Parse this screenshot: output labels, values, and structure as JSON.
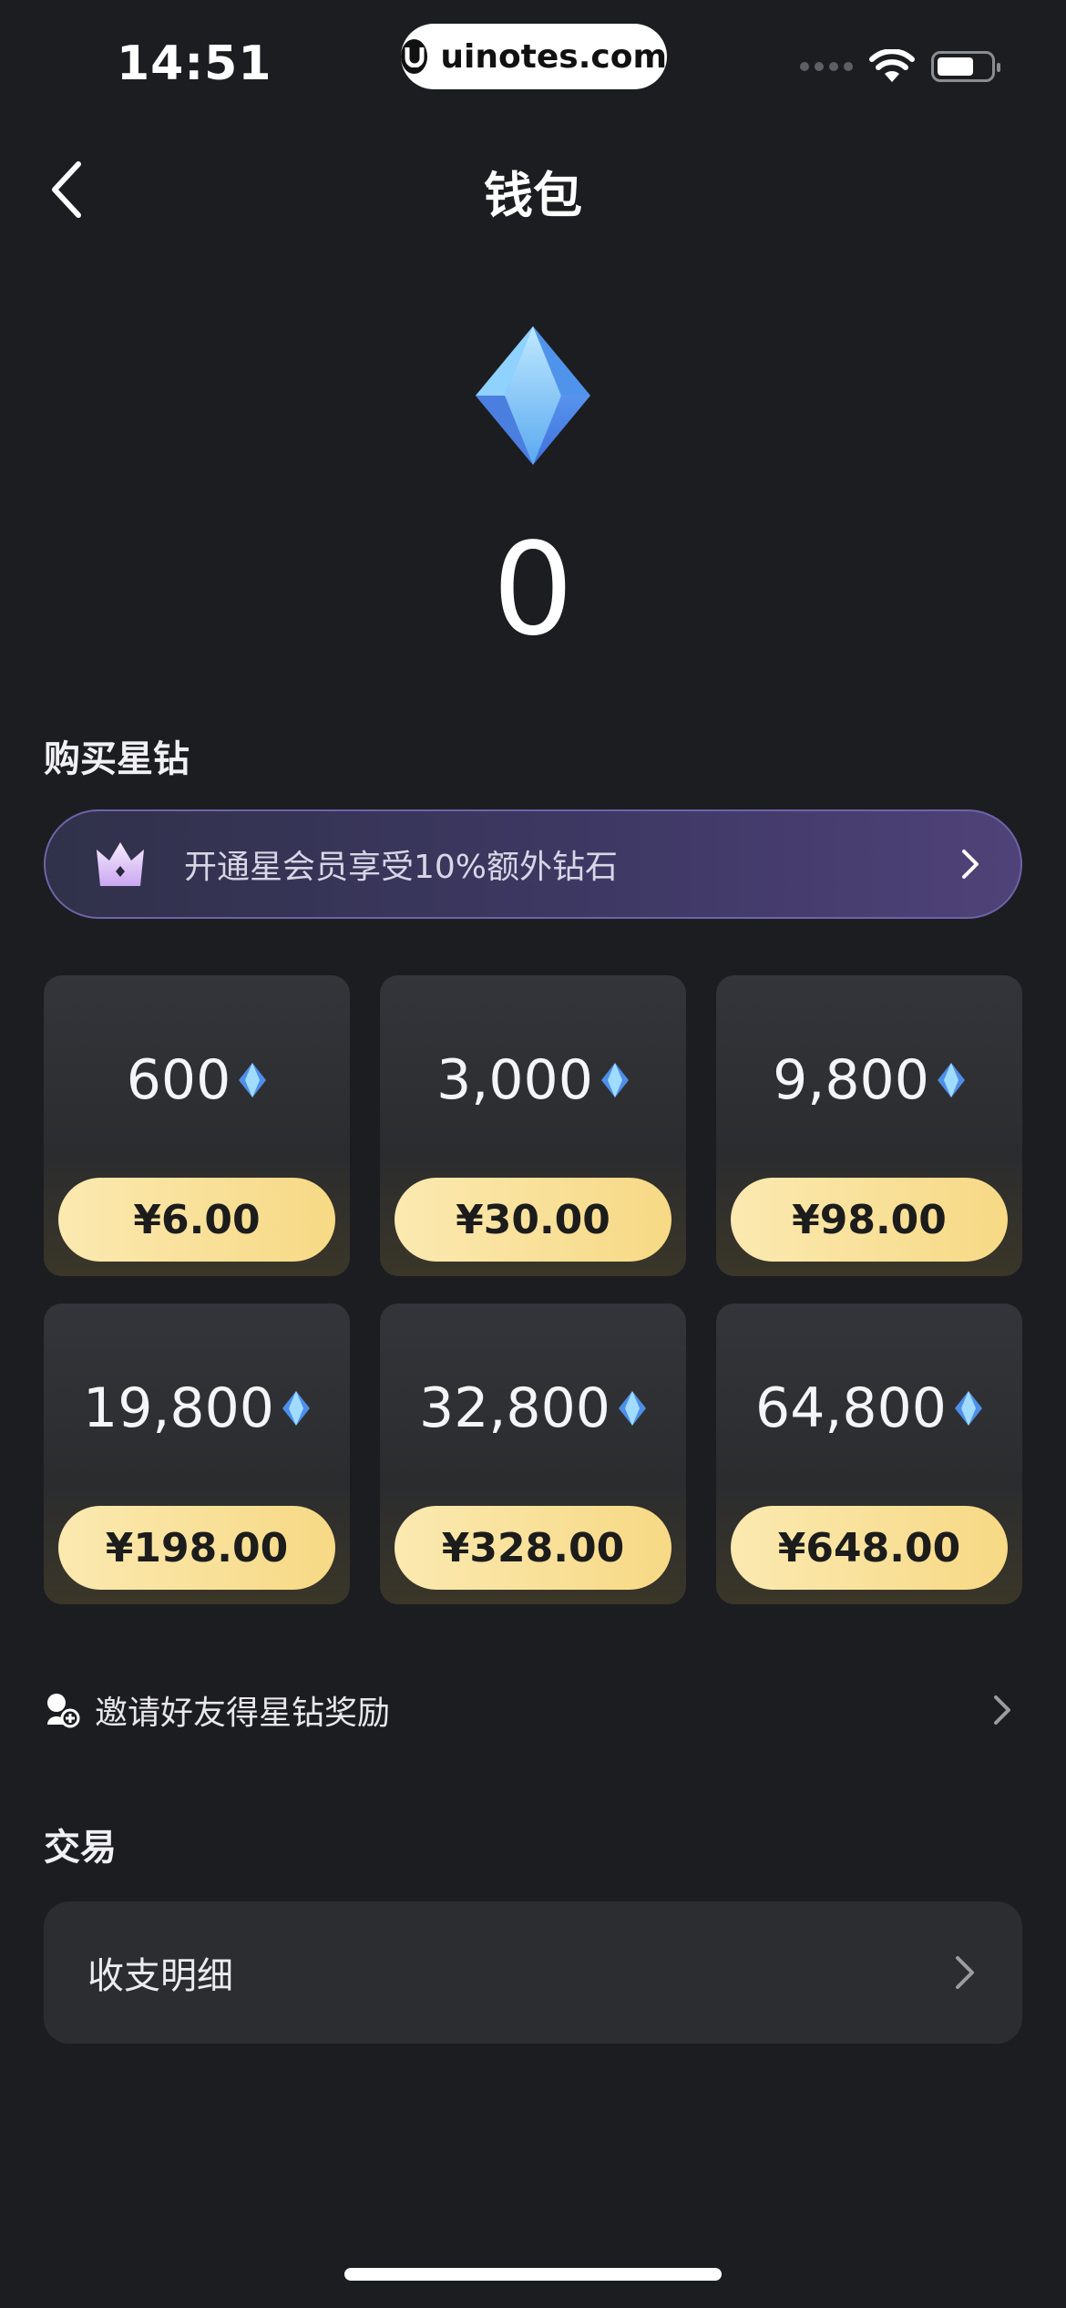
{
  "status_bar": {
    "time": "14:51",
    "watermark": "uinotes.com"
  },
  "nav": {
    "title": "钱包"
  },
  "wallet": {
    "balance": "0"
  },
  "purchase": {
    "section_title": "购买星钻",
    "vip_banner_text": "开通星会员享受10%额外钻石",
    "packages": [
      {
        "amount": "600",
        "price": "¥6.00"
      },
      {
        "amount": "3,000",
        "price": "¥30.00"
      },
      {
        "amount": "9,800",
        "price": "¥98.00"
      },
      {
        "amount": "19,800",
        "price": "¥198.00"
      },
      {
        "amount": "32,800",
        "price": "¥328.00"
      },
      {
        "amount": "64,800",
        "price": "¥648.00"
      }
    ]
  },
  "invite": {
    "text": "邀请好友得星钻奖励"
  },
  "transactions": {
    "section_title": "交易",
    "details_label": "收支明细"
  },
  "colors": {
    "background": "#1c1d21",
    "price_pill": "#f7d985",
    "card": "#2c2d31",
    "vip_border": "#6e63a8"
  }
}
